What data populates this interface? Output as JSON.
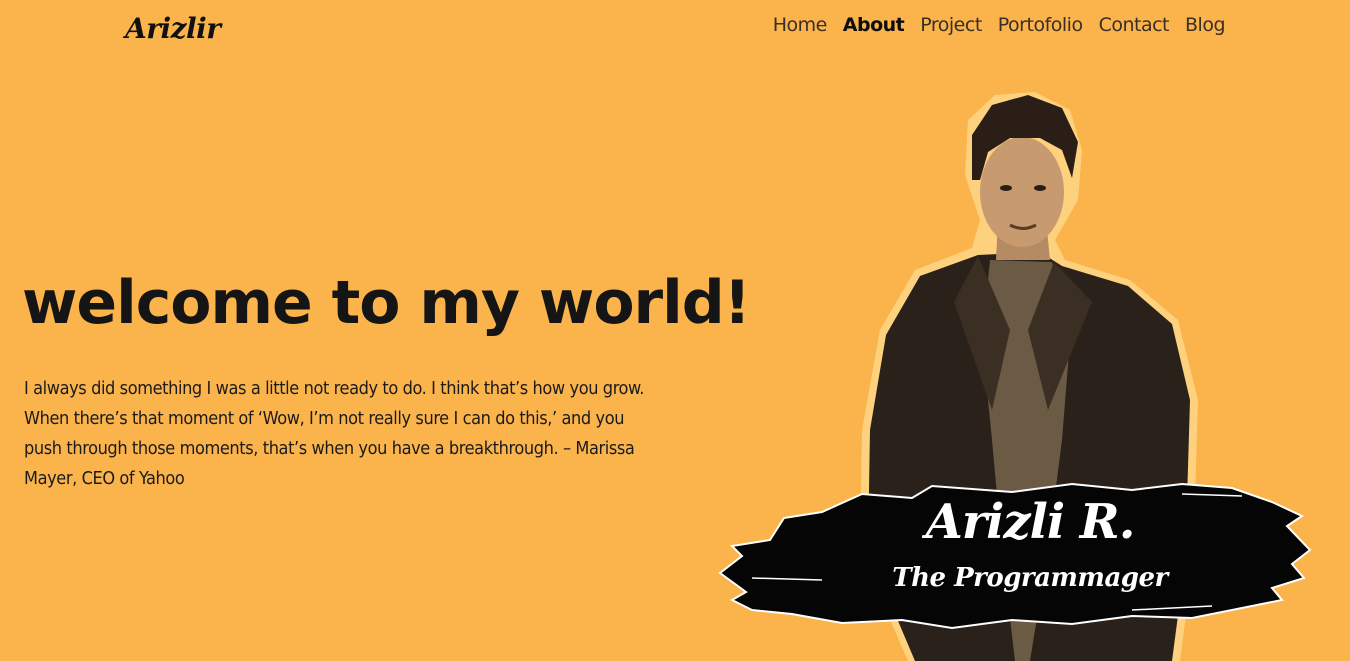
{
  "header": {
    "logo": "Arizlir",
    "nav": [
      {
        "label": "Home"
      },
      {
        "label": "About"
      },
      {
        "label": "Project"
      },
      {
        "label": "Portofolio"
      },
      {
        "label": "Contact"
      },
      {
        "label": "Blog"
      }
    ]
  },
  "hero": {
    "title": "welcome to my world!",
    "quote": "I always did something I was a little not ready to do. I think that’s how you grow. When there’s that moment of ‘Wow, I’m not really sure I can do this,’ and you push through those moments, that’s when you have a breakthrough. – Marissa Mayer, CEO of Yahoo"
  },
  "profile": {
    "name": "Arizli R.",
    "role": "The Programmager"
  },
  "colors": {
    "background": "#FBB34C",
    "banner": "#050505",
    "text": "#1b1b1b"
  }
}
